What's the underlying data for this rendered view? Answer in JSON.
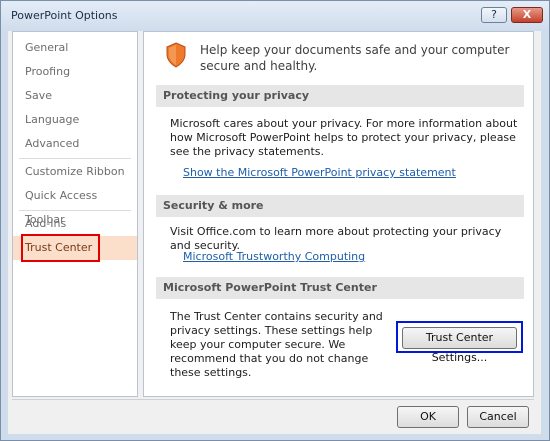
{
  "window": {
    "title": "PowerPoint Options",
    "help_label": "?",
    "close_label": "X"
  },
  "sidebar": {
    "items": [
      {
        "label": "General"
      },
      {
        "label": "Proofing"
      },
      {
        "label": "Save"
      },
      {
        "label": "Language"
      },
      {
        "label": "Advanced"
      },
      {
        "label": "Customize Ribbon"
      },
      {
        "label": "Quick Access Toolbar"
      },
      {
        "label": "Add-Ins"
      },
      {
        "label": "Trust Center"
      }
    ],
    "selected": "Trust Center"
  },
  "main": {
    "intro": "Help keep your documents safe and your computer secure and healthy.",
    "privacy": {
      "header": "Protecting your privacy",
      "text": "Microsoft cares about your privacy. For more information about how Microsoft PowerPoint helps to protect your privacy, please see the privacy statements.",
      "link": "Show the Microsoft PowerPoint privacy statement"
    },
    "security": {
      "header": "Security & more",
      "text": "Visit Office.com to learn more about protecting your privacy and security.",
      "link": "Microsoft Trustworthy Computing"
    },
    "trust_center": {
      "header": "Microsoft PowerPoint Trust Center",
      "text": "The Trust Center contains security and privacy settings. These settings help keep your computer secure. We recommend that you do not change these settings.",
      "button": "Trust Center Settings..."
    }
  },
  "footer": {
    "ok": "OK",
    "cancel": "Cancel"
  },
  "colors": {
    "selected_bg": "#fbdfca",
    "link": "#1f5ea8",
    "highlight_red": "#e00000",
    "highlight_blue": "#0018d8"
  },
  "icons": {
    "intro": "shield-icon"
  }
}
